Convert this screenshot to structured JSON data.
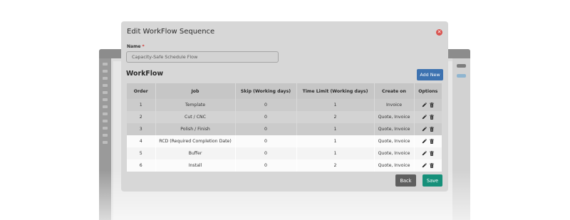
{
  "modal": {
    "title": "Edit WorkFlow Sequence",
    "name_label": "Name",
    "required_mark": "*",
    "name_value": "Capacity-Safe Schedule Flow",
    "section_title": "WorkFlow",
    "add_button": "Add New",
    "columns": [
      "Order",
      "Job",
      "Skip (Working days)",
      "Time Limit (Working days)",
      "Create on",
      "Options"
    ],
    "rows": [
      {
        "order": "1",
        "job": "Template",
        "skip": "0",
        "limit": "1",
        "create_on": "Invoice"
      },
      {
        "order": "2",
        "job": "Cut / CNC",
        "skip": "0",
        "limit": "2",
        "create_on": "Quote, Invoice"
      },
      {
        "order": "3",
        "job": "Polish / Finish",
        "skip": "0",
        "limit": "1",
        "create_on": "Quote, Invoice"
      },
      {
        "order": "4",
        "job": "RCD (Required Completion Date)",
        "skip": "0",
        "limit": "1",
        "create_on": "Quote, Invoice"
      },
      {
        "order": "5",
        "job": "Buffer",
        "skip": "0",
        "limit": "1",
        "create_on": "Quote, Invoice"
      },
      {
        "order": "6",
        "job": "Install",
        "skip": "0",
        "limit": "2",
        "create_on": "Quote, Invoice"
      }
    ],
    "back_button": "Back",
    "save_button": "Save",
    "row_icons": [
      "pencil-icon",
      "trash-icon"
    ]
  },
  "colors": {
    "add_button": "#3d72b0",
    "save_button": "#16907a",
    "back_button": "#5f5f5f",
    "close_icon": "#d9534f",
    "required_mark": "#d0312d"
  }
}
